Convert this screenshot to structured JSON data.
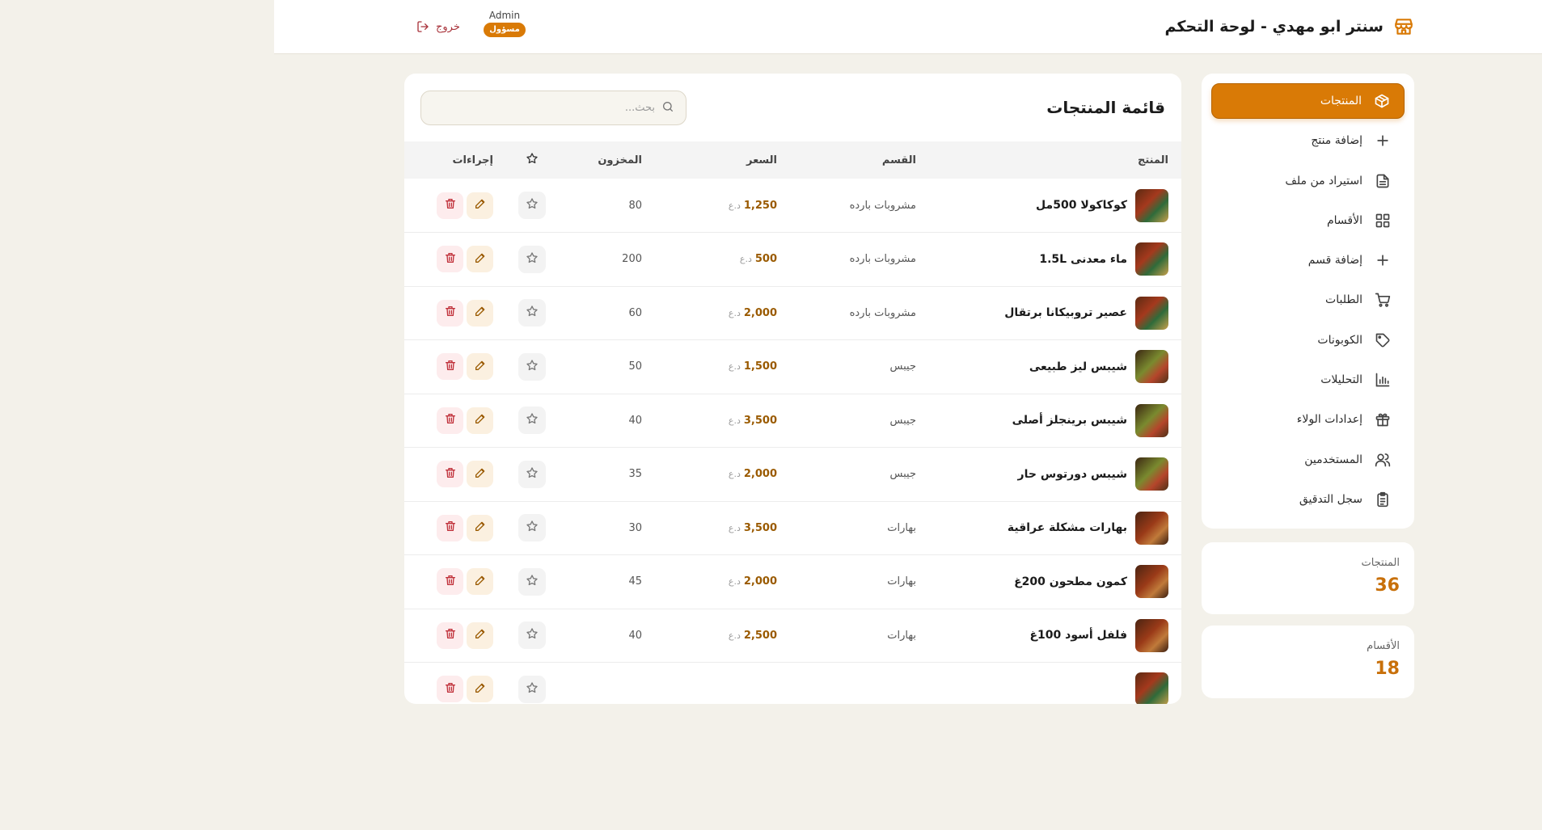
{
  "header": {
    "title": "سنتر ابو مهدي - لوحة التحكم",
    "user_name": "Admin",
    "role_badge": "مسؤول",
    "logout_label": "خروج"
  },
  "sidebar": {
    "items": [
      {
        "label": "المنتجات",
        "icon": "box-icon",
        "active": true
      },
      {
        "label": "إضافة منتج",
        "icon": "plus-icon"
      },
      {
        "label": "استيراد من ملف",
        "icon": "file-icon"
      },
      {
        "label": "الأقسام",
        "icon": "grid-icon"
      },
      {
        "label": "إضافة قسم",
        "icon": "plus-icon"
      },
      {
        "label": "الطلبات",
        "icon": "cart-icon"
      },
      {
        "label": "الكوبونات",
        "icon": "tag-icon"
      },
      {
        "label": "التحليلات",
        "icon": "chart-icon"
      },
      {
        "label": "إعدادات الولاء",
        "icon": "gift-icon"
      },
      {
        "label": "المستخدمين",
        "icon": "users-icon"
      },
      {
        "label": "سجل التدقيق",
        "icon": "clipboard-icon"
      }
    ]
  },
  "stats": {
    "products": {
      "label": "المنتجات",
      "value": "36"
    },
    "categories": {
      "label": "الأقسام",
      "value": "18"
    }
  },
  "main": {
    "title": "قائمة المنتجات",
    "search_placeholder": "بحث...",
    "columns": {
      "product": "المنتج",
      "category": "القسم",
      "price": "السعر",
      "stock": "المخزون",
      "actions": "إجراءات"
    },
    "currency": "د.ع",
    "rows": [
      {
        "name": "كوكاكولا 500مل",
        "category": "مشروبات بارده",
        "price": "1,250",
        "stock": "80",
        "thumb": "drinks"
      },
      {
        "name": "ماء معدنى 1.5L",
        "category": "مشروبات بارده",
        "price": "500",
        "stock": "200",
        "thumb": "drinks"
      },
      {
        "name": "عصير تروبيكانا برتقال",
        "category": "مشروبات بارده",
        "price": "2,000",
        "stock": "60",
        "thumb": "drinks"
      },
      {
        "name": "شيبس ليز طبيعى",
        "category": "جيبس",
        "price": "1,500",
        "stock": "50",
        "thumb": "chips"
      },
      {
        "name": "شيبس برينجلز أصلى",
        "category": "جيبس",
        "price": "3,500",
        "stock": "40",
        "thumb": "chips"
      },
      {
        "name": "شيبس دورتوس حار",
        "category": "جيبس",
        "price": "2,000",
        "stock": "35",
        "thumb": "chips"
      },
      {
        "name": "بهارات مشكلة عراقية",
        "category": "بهارات",
        "price": "3,500",
        "stock": "30",
        "thumb": "spices"
      },
      {
        "name": "كمون مطحون 200غ",
        "category": "بهارات",
        "price": "2,000",
        "stock": "45",
        "thumb": "spices"
      },
      {
        "name": "فلفل أسود 100غ",
        "category": "بهارات",
        "price": "2,500",
        "stock": "40",
        "thumb": "spices"
      },
      {
        "name": "",
        "category": "",
        "price": "",
        "stock": "",
        "thumb": "drinks"
      }
    ]
  },
  "colors": {
    "accent": "#d97a06",
    "price": "#9a5a00",
    "danger": "#c0303a",
    "background": "#f3f1ea"
  }
}
